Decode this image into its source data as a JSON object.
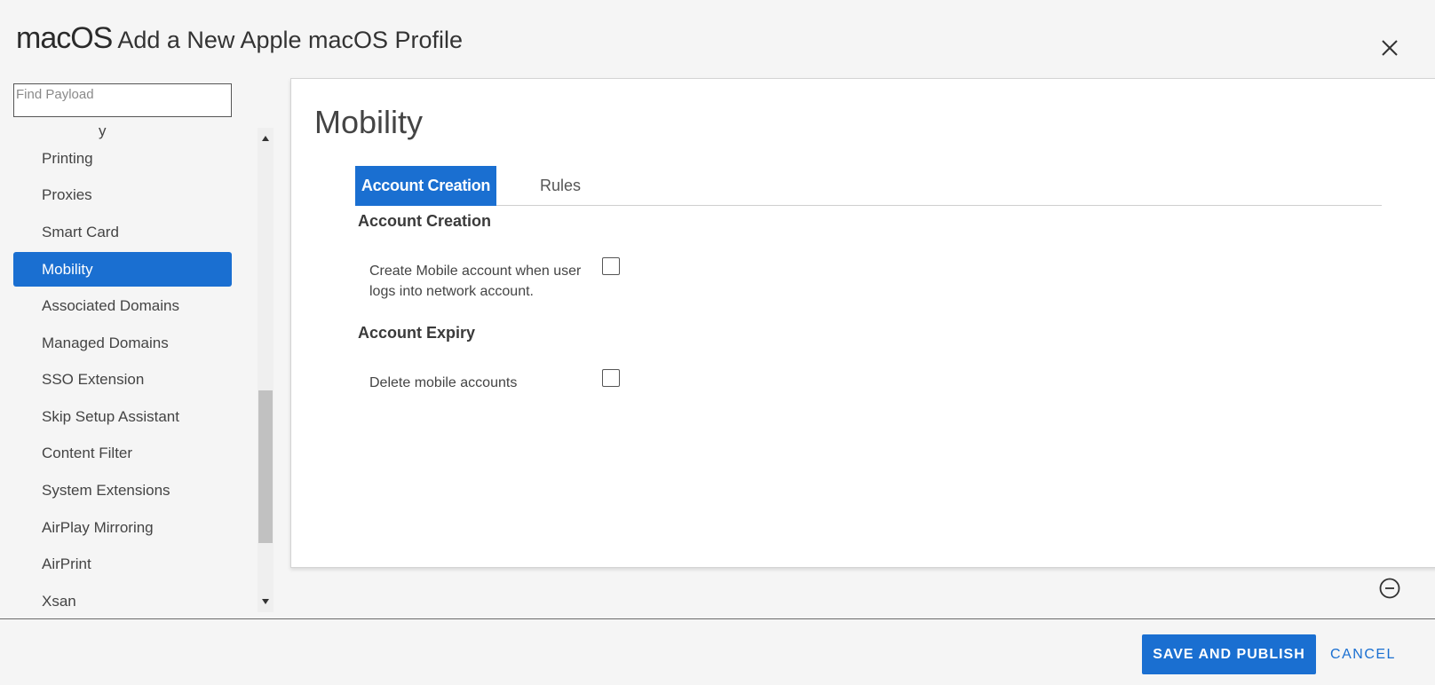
{
  "header": {
    "os_label": "macOS",
    "title": "Add a New Apple macOS Profile"
  },
  "search": {
    "placeholder": "Find Payload"
  },
  "sidebar": {
    "partial_item": "y",
    "items": [
      {
        "label": "Printing"
      },
      {
        "label": "Proxies"
      },
      {
        "label": "Smart Card"
      },
      {
        "label": "Mobility",
        "active": true
      },
      {
        "label": "Associated Domains"
      },
      {
        "label": "Managed Domains"
      },
      {
        "label": "SSO Extension"
      },
      {
        "label": "Skip Setup Assistant"
      },
      {
        "label": "Content Filter"
      },
      {
        "label": "System Extensions"
      },
      {
        "label": "AirPlay Mirroring"
      },
      {
        "label": "AirPrint"
      },
      {
        "label": "Xsan"
      }
    ]
  },
  "panel": {
    "title": "Mobility",
    "tabs": [
      {
        "label": "Account Creation",
        "active": true
      },
      {
        "label": "Rules",
        "active": false
      }
    ],
    "sections": [
      {
        "heading": "Account Creation",
        "field_label": "Create Mobile account when user logs into network account.",
        "checked": false
      },
      {
        "heading": "Account Expiry",
        "field_label": "Delete mobile accounts",
        "checked": false
      }
    ]
  },
  "footer": {
    "save_label": "SAVE AND PUBLISH",
    "cancel_label": "CANCEL"
  },
  "colors": {
    "accent": "#1a6fd1",
    "background": "#f5f5f5"
  },
  "icons": {
    "close": "close-icon",
    "remove": "minus-circle-icon",
    "scroll_up": "triangle-up-icon",
    "scroll_down": "triangle-down-icon"
  }
}
